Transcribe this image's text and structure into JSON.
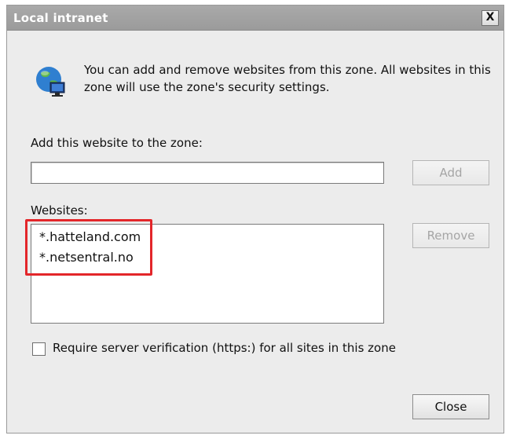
{
  "window": {
    "title": "Local intranet",
    "close_glyph": "X"
  },
  "info": {
    "icon": "globe-computer-icon",
    "text": "You can add and remove websites from this zone. All websites in this zone will use the zone's security settings."
  },
  "add_section": {
    "label": "Add this website to the zone:",
    "input_value": "",
    "add_button": "Add"
  },
  "websites_section": {
    "label": "Websites:",
    "items": [
      "*.hatteland.com",
      "*.netsentral.no"
    ],
    "remove_button": "Remove"
  },
  "https_checkbox": {
    "label": "Require server verification (https:) for all sites in this zone",
    "checked": false
  },
  "close_button": "Close",
  "colors": {
    "highlight_border": "#e3262a",
    "titlebar": "#a3a3a3",
    "dialog_bg": "#ececec"
  }
}
